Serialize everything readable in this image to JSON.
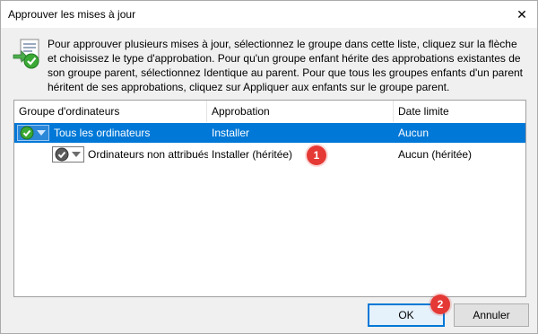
{
  "window": {
    "title": "Approuver les mises à jour",
    "close_glyph": "✕"
  },
  "description": "Pour approuver plusieurs mises à jour, sélectionnez le groupe dans cette liste, cliquez sur la flèche et choisissez le type d'approbation. Pour qu'un groupe enfant hérite des approbations existantes de son groupe parent, sélectionnez Identique au parent. Pour que tous les groupes enfants d'un parent héritent de ses approbations, cliquez sur Appliquer aux enfants sur le groupe parent.",
  "table": {
    "columns": [
      "Groupe d'ordinateurs",
      "Approbation",
      "Date limite"
    ],
    "rows": [
      {
        "group": "Tous les ordinateurs",
        "approval": "Installer",
        "deadline": "Aucun",
        "selected": true
      },
      {
        "group": "Ordinateurs non attribués",
        "approval": "Installer (héritée)",
        "deadline": "Aucun (héritée)",
        "selected": false
      }
    ]
  },
  "annotations": {
    "badge_1": "1",
    "badge_2": "2"
  },
  "buttons": {
    "ok": "OK",
    "cancel": "Annuler"
  },
  "icons": {
    "app": "update-approve-icon",
    "status": "approved-check-icon",
    "dropdown": "dropdown-arrow-icon"
  },
  "colors": {
    "selection": "#0078d7",
    "badge": "#e53935",
    "approve_green": "#3aa935"
  }
}
